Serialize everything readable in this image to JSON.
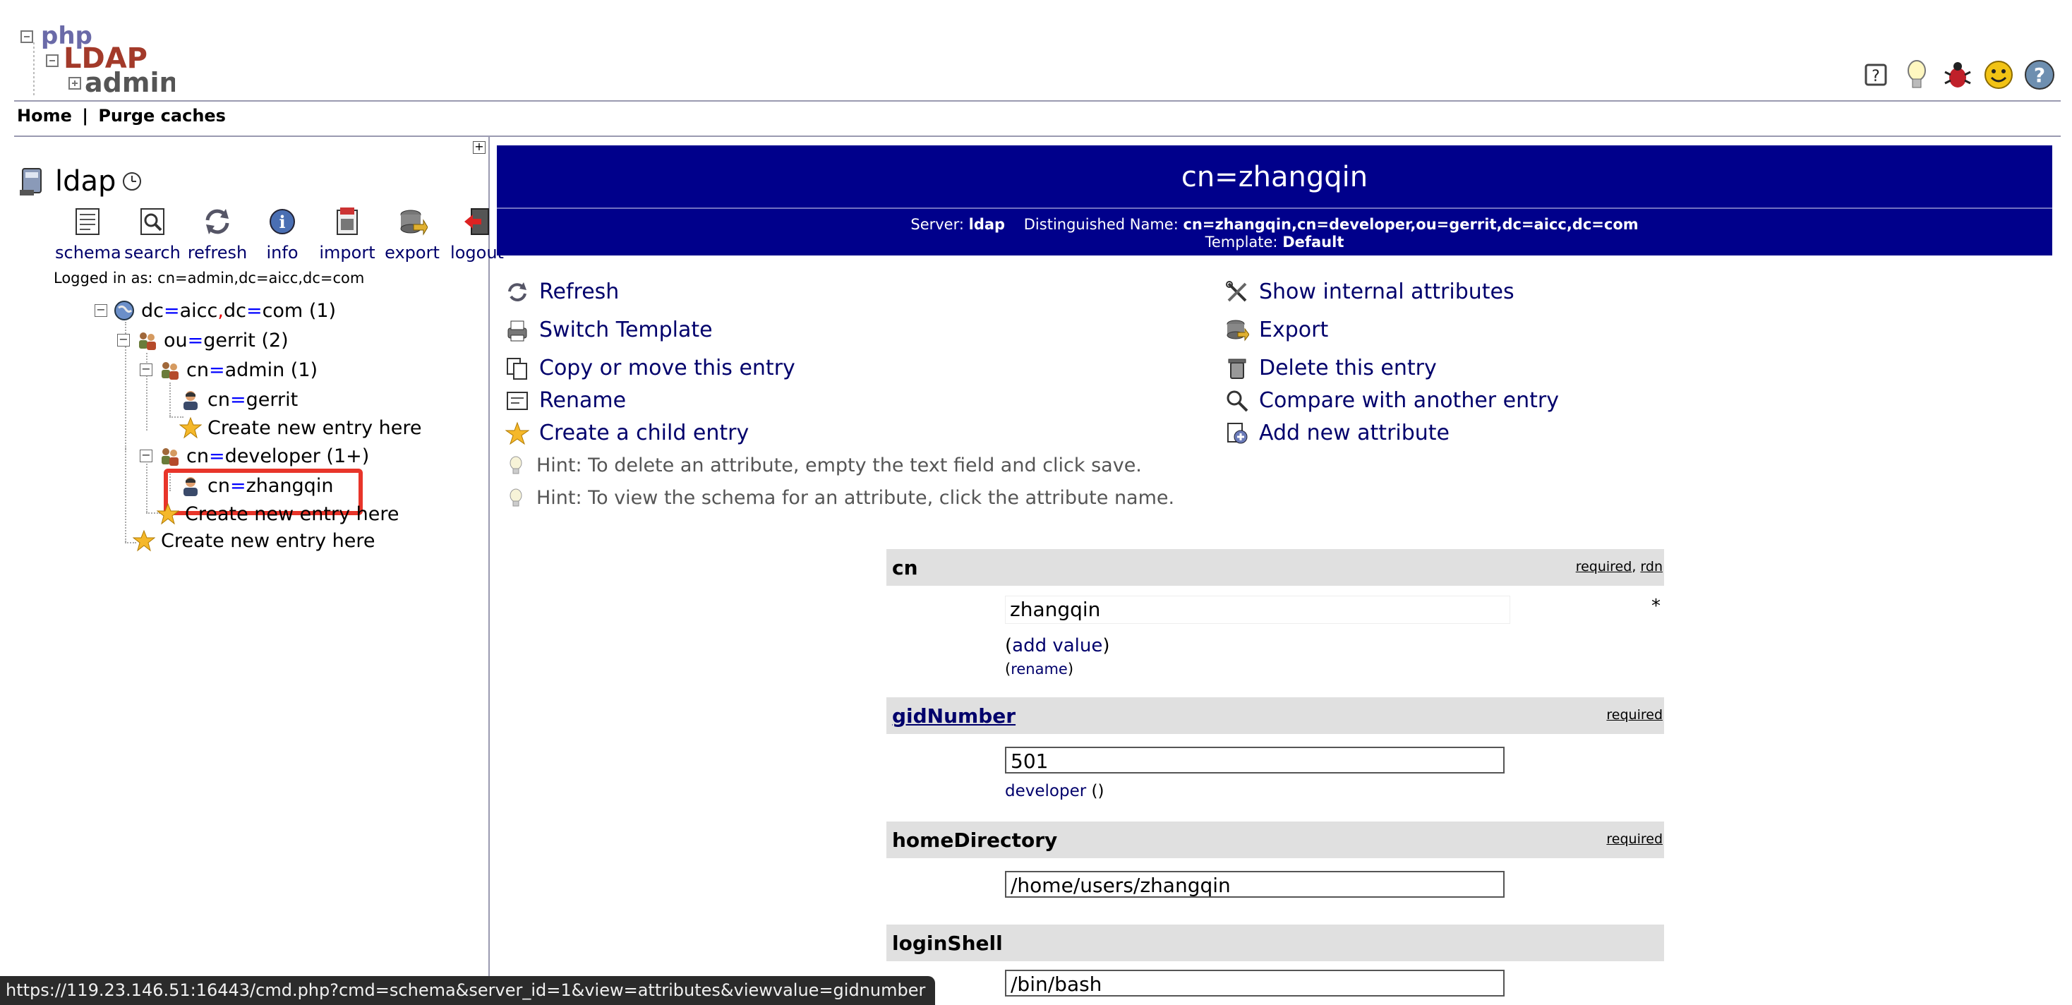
{
  "header": {
    "logo_text": {
      "php": "php",
      "ldap": "LDAP",
      "admin": "admin"
    },
    "icons": [
      "help-icon",
      "hint-icon",
      "bug-icon",
      "smile-icon",
      "question-icon"
    ]
  },
  "menu": {
    "home": "Home",
    "separator": "|",
    "purge": "Purge caches"
  },
  "left": {
    "server_name": "ldap",
    "toolbar": [
      {
        "label": "schema",
        "icon": "schema-icon"
      },
      {
        "label": "search",
        "icon": "search-icon"
      },
      {
        "label": "refresh",
        "icon": "refresh-icon"
      },
      {
        "label": "info",
        "icon": "info-icon"
      },
      {
        "label": "import",
        "icon": "import-icon"
      },
      {
        "label": "export",
        "icon": "export-icon"
      },
      {
        "label": "logout",
        "icon": "logout-icon"
      }
    ],
    "logged_in": "Logged in as: cn=admin,dc=aicc,dc=com",
    "tree": {
      "root": {
        "a": "dc",
        "b": "aicc",
        "c": "dc",
        "d": "com",
        "count": "(1)"
      },
      "ou": {
        "k": "ou",
        "v": "gerrit",
        "count": "(2)"
      },
      "admin": {
        "k": "cn",
        "v": "admin",
        "count": "(1)"
      },
      "gerrit": {
        "k": "cn",
        "v": "gerrit"
      },
      "create1": "Create new entry here",
      "developer": {
        "k": "cn",
        "v": "developer",
        "count": "(1+)"
      },
      "zhangqin": {
        "k": "cn",
        "v": "zhangqin"
      },
      "create2": "Create new entry here",
      "create3": "Create new entry here"
    }
  },
  "banner": {
    "title": "cn=zhangqin",
    "server_label": "Server:",
    "server": "ldap",
    "dn_label": "Distinguished Name:",
    "dn": "cn=zhangqin,cn=developer,ou=gerrit,dc=aicc,dc=com",
    "template_label": "Template:",
    "template": "Default"
  },
  "actions": {
    "refresh": "Refresh",
    "switch_template": "Switch Template",
    "copy_move": "Copy or move this entry",
    "rename": "Rename",
    "create_child": "Create a child entry",
    "hint1": "Hint: To delete an attribute, empty the text field and click save.",
    "hint2": "Hint: To view the schema for an attribute, click the attribute name.",
    "show_internal": "Show internal attributes",
    "export": "Export",
    "delete": "Delete this entry",
    "compare": "Compare with another entry",
    "add_attribute": "Add new attribute"
  },
  "attributes": {
    "cn": {
      "name": "cn",
      "flag1": "required",
      "flag_sep": ", ",
      "flag2": "rdn",
      "value": "zhangqin",
      "star": "*",
      "add_value": "add value",
      "rename": "rename"
    },
    "gid": {
      "name": "gidNumber",
      "flag": "required",
      "value": "501",
      "group": "developer",
      "group_suffix": " ()"
    },
    "home": {
      "name": "homeDirectory",
      "flag": "required",
      "value": "/home/users/zhangqin"
    },
    "shell": {
      "name": "loginShell",
      "value": "/bin/bash"
    }
  },
  "statusbar": "https://119.23.146.51:16443/cmd.php?cmd=schema&server_id=1&view=attributes&viewvalue=gidnumber"
}
